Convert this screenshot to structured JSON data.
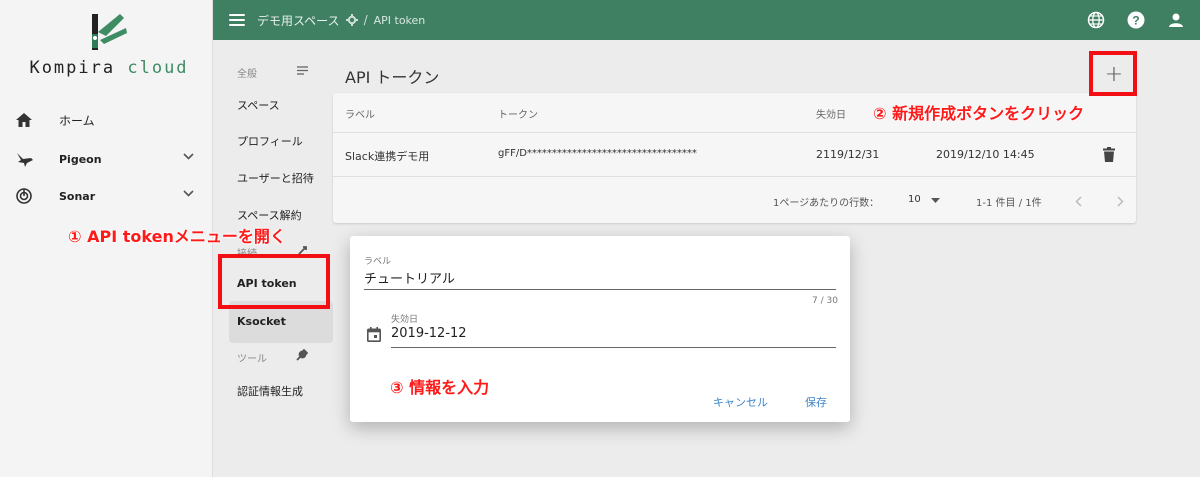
{
  "logo": {
    "text_a": "Kompira",
    "text_b": "cloud"
  },
  "sidebar": {
    "items": [
      {
        "label": "ホーム",
        "icon": "home-icon"
      },
      {
        "label": "Pigeon",
        "icon": "pigeon-icon",
        "expandable": true
      },
      {
        "label": "Sonar",
        "icon": "sonar-icon",
        "expandable": true
      }
    ]
  },
  "topbar": {
    "space": "デモ用スペース",
    "current": "API token",
    "icons": [
      "globe-icon",
      "help-icon",
      "account-icon"
    ],
    "color": "#3f7f62"
  },
  "settings_nav": {
    "section_general": "全般",
    "items_general": [
      "スペース",
      "プロフィール",
      "ユーザーと招待",
      "スペース解約"
    ],
    "section_connect": "接続",
    "items_connect": [
      "API token",
      "Ksocket"
    ],
    "section_tools": "ツール",
    "items_tools": [
      "認証情報生成"
    ]
  },
  "main": {
    "title": "API トークン",
    "add_label": "+",
    "table": {
      "headers": [
        "ラベル",
        "トークン",
        "失効日",
        ""
      ],
      "rows": [
        {
          "label": "Slack連携デモ用",
          "token": "gFF/D**********************************",
          "expire": "2119/12/31",
          "created": "2019/12/10 14:45"
        }
      ],
      "footer": {
        "rows_per_page_label": "1ページあたりの行数：",
        "rows_per_page": "10",
        "range": "1-1 件目 / 1件"
      }
    }
  },
  "dialog": {
    "label_caption": "ラベル",
    "label_value": "チュートリアル",
    "counter": "7 / 30",
    "date_caption": "失効日",
    "date_value": "2019-12-12",
    "cancel": "キャンセル",
    "save": "保存"
  },
  "annotations": {
    "step1": "① API tokenメニューを開く",
    "step2": "② 新規作成ボタンをクリック",
    "step3": "③ 情報を入力",
    "color": "#f20f14"
  }
}
